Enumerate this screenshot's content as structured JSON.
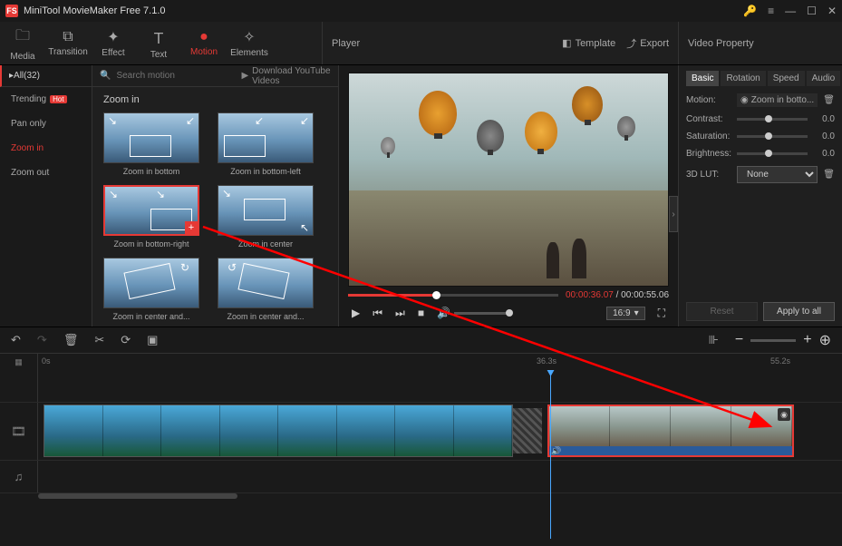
{
  "app": {
    "title": "MiniTool MovieMaker Free 7.1.0"
  },
  "toolbar": {
    "tabs": {
      "media": "Media",
      "transition": "Transition",
      "effect": "Effect",
      "text": "Text",
      "motion": "Motion",
      "elements": "Elements"
    },
    "player_label": "Player",
    "template": "Template",
    "export": "Export",
    "property_label": "Video Property"
  },
  "sidebar": {
    "all_label": "All(32)",
    "cats": [
      "Trending",
      "Pan only",
      "Zoom in",
      "Zoom out"
    ],
    "hot": "Hot"
  },
  "search": {
    "placeholder": "Search motion",
    "yt": "Download YouTube Videos"
  },
  "gallery": {
    "section": "Zoom in",
    "items": [
      "Zoom in bottom",
      "Zoom in bottom-left",
      "Zoom in bottom-right",
      "Zoom in center",
      "Zoom in center and...",
      "Zoom in center and..."
    ]
  },
  "player": {
    "current": "00:00:36.07",
    "duration": "00:00:55.06",
    "ratio": "16:9"
  },
  "props": {
    "tabs": [
      "Basic",
      "Rotation",
      "Speed",
      "Audio"
    ],
    "motion_label": "Motion:",
    "motion_value": "Zoom in botto...",
    "contrast_label": "Contrast:",
    "contrast_val": "0.0",
    "saturation_label": "Saturation:",
    "saturation_val": "0.0",
    "brightness_label": "Brightness:",
    "brightness_val": "0.0",
    "lut_label": "3D LUT:",
    "lut_value": "None",
    "reset": "Reset",
    "apply": "Apply to all"
  },
  "ruler": {
    "t0": "0s",
    "t1": "36.3s",
    "t2": "55.2s"
  }
}
